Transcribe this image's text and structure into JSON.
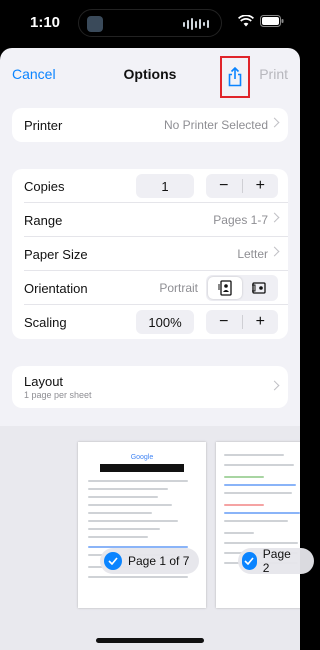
{
  "status": {
    "time": "1:10"
  },
  "nav": {
    "cancel": "Cancel",
    "title": "Options",
    "print": "Print"
  },
  "printer": {
    "label": "Printer",
    "value": "No Printer Selected"
  },
  "settings": {
    "copies_label": "Copies",
    "copies_value": "1",
    "range_label": "Range",
    "range_value": "Pages 1-7",
    "paper_label": "Paper Size",
    "paper_value": "Letter",
    "orientation_label": "Orientation",
    "orientation_value": "Portrait",
    "scaling_label": "Scaling",
    "scaling_value": "100%",
    "minus": "−",
    "plus": "+"
  },
  "layout": {
    "label": "Layout",
    "value": "1 page per sheet"
  },
  "preview": {
    "page1_badge": "Page 1 of 7",
    "page2_badge": "Page 2",
    "page1_logo": "Google"
  },
  "colors": {
    "accent": "#0a84ff",
    "highlight": "#e0242a"
  },
  "icons": [
    "share-icon",
    "chevron-right-icon",
    "portrait-orientation-icon",
    "landscape-orientation-icon",
    "checkmark-icon",
    "wifi-icon",
    "battery-icon"
  ]
}
